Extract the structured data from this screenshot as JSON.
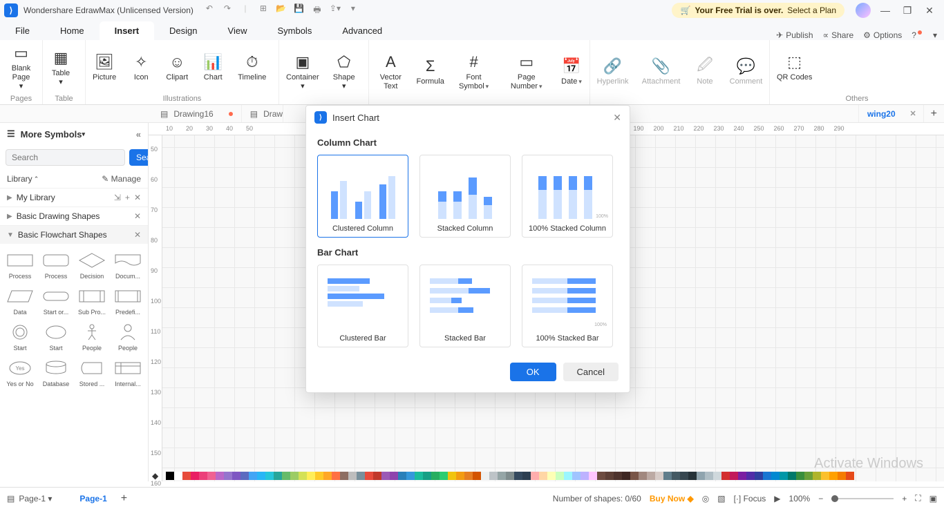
{
  "titlebar": {
    "app_title": "Wondershare EdrawMax (Unlicensed Version)",
    "trial_text_1": "Your Free Trial is over.",
    "trial_text_2": "Select a Plan"
  },
  "menubar": {
    "tabs": [
      "File",
      "Home",
      "Insert",
      "Design",
      "View",
      "Symbols",
      "Advanced"
    ],
    "active": "Insert",
    "publish": "Publish",
    "share": "Share",
    "options": "Options"
  },
  "ribbon": {
    "groups": {
      "pages": {
        "label": "Pages",
        "buttons": [
          {
            "l": "Blank Page",
            "dd": true
          }
        ]
      },
      "table": {
        "label": "Table",
        "buttons": [
          {
            "l": "Table",
            "dd": true
          }
        ]
      },
      "illustrations": {
        "label": "Illustrations",
        "buttons": [
          {
            "l": "Picture"
          },
          {
            "l": "Icon"
          },
          {
            "l": "Clipart"
          },
          {
            "l": "Chart"
          },
          {
            "l": "Timeline"
          }
        ]
      },
      "container": {
        "label": "",
        "buttons": [
          {
            "l": "Container",
            "dd": true
          },
          {
            "l": "Shape",
            "dd": true
          }
        ]
      },
      "text": {
        "label": "",
        "buttons": [
          {
            "l": "Vector Text"
          },
          {
            "l": "Formula"
          },
          {
            "l": "Font Symbol",
            "dd": true
          },
          {
            "l": "Page Number",
            "dd": true
          },
          {
            "l": "Date",
            "dd": true
          }
        ]
      },
      "links": {
        "label": "",
        "buttons": [
          {
            "l": "Hyperlink",
            "d": true
          },
          {
            "l": "Attachment",
            "d": true
          },
          {
            "l": "Note",
            "d": true
          },
          {
            "l": "Comment",
            "d": true
          }
        ]
      },
      "others": {
        "label": "Others",
        "buttons": [
          {
            "l": "QR Codes"
          }
        ]
      }
    }
  },
  "doc_tabs": {
    "tabs": [
      {
        "name": "Drawing16",
        "unsaved": true
      },
      {
        "name": "Draw",
        "partial": true
      },
      {
        "name": "wing20",
        "active": true,
        "partial": true
      }
    ]
  },
  "ruler_h": [
    10,
    20,
    30,
    40,
    50,
    180,
    190,
    200,
    210,
    220,
    230,
    240,
    250,
    260,
    270,
    280,
    290
  ],
  "ruler_v": [
    50,
    60,
    70,
    80,
    90,
    100,
    110,
    120,
    130,
    140,
    150,
    160
  ],
  "sidebar": {
    "header": "More Symbols",
    "search_ph": "Search",
    "search_btn": "Search",
    "library_label": "Library",
    "manage_label": "Manage",
    "sections": [
      {
        "name": "My Library",
        "icons": true
      },
      {
        "name": "Basic Drawing Shapes",
        "close": true
      },
      {
        "name": "Basic Flowchart Shapes",
        "open": true,
        "close": true
      }
    ],
    "shapes": [
      {
        "name": "Process",
        "k": "rect"
      },
      {
        "name": "Process",
        "k": "rrect"
      },
      {
        "name": "Decision",
        "k": "diamond"
      },
      {
        "name": "Docum...",
        "k": "doc"
      },
      {
        "name": "Data",
        "k": "para"
      },
      {
        "name": "Start or...",
        "k": "pill"
      },
      {
        "name": "Sub Pro...",
        "k": "subp"
      },
      {
        "name": "Predefi...",
        "k": "pred"
      },
      {
        "name": "Start",
        "k": "circ-outline"
      },
      {
        "name": "Start",
        "k": "ellipse"
      },
      {
        "name": "People",
        "k": "stick"
      },
      {
        "name": "People",
        "k": "person"
      },
      {
        "name": "Yes or No",
        "k": "yesno"
      },
      {
        "name": "Database",
        "k": "db"
      },
      {
        "name": "Stored ...",
        "k": "stored"
      },
      {
        "name": "Internal...",
        "k": "internal"
      }
    ]
  },
  "dialog": {
    "title": "Insert Chart",
    "section_column": "Column Chart",
    "section_bar": "Bar Chart",
    "ok": "OK",
    "cancel": "Cancel",
    "col_charts": [
      {
        "label": "Clustered Column",
        "k": "clustered-col",
        "selected": true
      },
      {
        "label": "Stacked Column",
        "k": "stacked-col"
      },
      {
        "label": "100% Stacked Column",
        "k": "stacked100-col",
        "pct": "100%"
      }
    ],
    "bar_charts": [
      {
        "label": "Clustered Bar",
        "k": "clustered-bar"
      },
      {
        "label": "Stacked Bar",
        "k": "stacked-bar"
      },
      {
        "label": "100% Stacked Bar",
        "k": "stacked100-bar",
        "pct": "100%"
      }
    ]
  },
  "statusbar": {
    "page_dd": "Page-1",
    "page_tab": "Page-1",
    "shapes_count": "Number of shapes: 0/60",
    "buy_now": "Buy Now",
    "focus": "Focus",
    "zoom": "100%"
  },
  "watermark": "Activate Windows",
  "palette": [
    "#000",
    "#fff",
    "#e74c3c",
    "#e91e63",
    "#ec407a",
    "#f06292",
    "#ba68c8",
    "#9575cd",
    "#7e57c2",
    "#5c6bc0",
    "#42a5f5",
    "#29b6f6",
    "#26c6da",
    "#26a69a",
    "#66bb6a",
    "#9ccc65",
    "#d4e157",
    "#ffee58",
    "#ffca28",
    "#ffa726",
    "#ff7043",
    "#8d6e63",
    "#bdbdbd",
    "#78909c",
    "#e74c3c",
    "#c0392b",
    "#9b59b6",
    "#8e44ad",
    "#2980b9",
    "#3498db",
    "#1abc9c",
    "#16a085",
    "#27ae60",
    "#2ecc71",
    "#f1c40f",
    "#f39c12",
    "#e67e22",
    "#d35400",
    "#ecf0f1",
    "#bdc3c7",
    "#95a5a6",
    "#7f8c8d",
    "#34495e",
    "#2c3e50",
    "#ffadad",
    "#ffd6a5",
    "#fdffb6",
    "#caffbf",
    "#9bf6ff",
    "#a0c4ff",
    "#bdb2ff",
    "#ffc6ff",
    "#6d4c41",
    "#5d4037",
    "#4e342e",
    "#3e2723",
    "#795548",
    "#a1887f",
    "#bcaaa4",
    "#d7ccc8",
    "#607d8b",
    "#455a64",
    "#37474f",
    "#263238",
    "#90a4ae",
    "#b0bec5",
    "#cfd8dc",
    "#d32f2f",
    "#c2185b",
    "#7b1fa2",
    "#512da8",
    "#303f9f",
    "#1976d2",
    "#0288d1",
    "#0097a7",
    "#00796b",
    "#388e3c",
    "#689f38",
    "#afb42b",
    "#fbc02d",
    "#ffa000",
    "#f57c00",
    "#e64a19"
  ]
}
